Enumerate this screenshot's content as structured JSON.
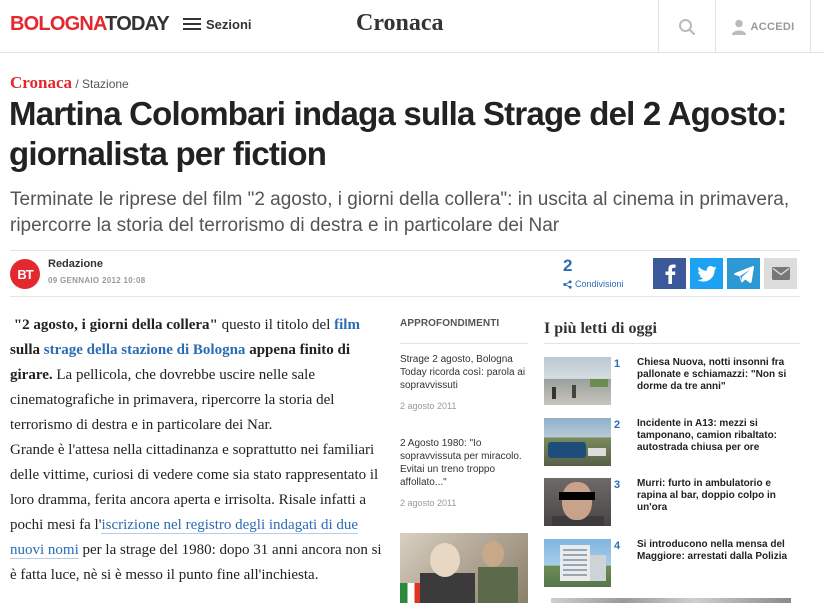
{
  "header": {
    "logo_part1": "BOLOGNA",
    "logo_part2": "TODAY",
    "menu_label": "Sezioni",
    "section_title": "Cronaca",
    "login_label": "ACCEDI"
  },
  "breadcrumb": {
    "category": "Cronaca",
    "separator": " / ",
    "subcategory": "Stazione"
  },
  "article": {
    "title": "Martina Colombari indaga sulla Strage del 2 Agosto: giornalista per fiction",
    "subtitle": "Terminate le riprese del film \"2 agosto, i giorni della collera\": in uscita al cinema in primavera, ripercorre la storia del terrorismo di destra e in particolare dei Nar",
    "author": {
      "avatar_text": "BT",
      "name": "Redazione",
      "date": "09 GENNAIO 2012 10:08"
    },
    "shares": {
      "count": "2",
      "label": "Condivisioni"
    },
    "body": {
      "p1_quote": "\"2 agosto, i giorni della collera\"",
      "p1_a": " questo il titolo del ",
      "link_film": "film",
      "p1_b": " sulla ",
      "link_strage": "strage della stazione di Bologna",
      "p1_c": " appena finito di girare.",
      "p1_d": " La pellicola, che dovrebbe uscire nelle sale cinematografiche in primavera, ripercorre la storia del terrorismo di destra e in particolare dei Nar.",
      "p2_a": "Grande è l'attesa nella cittadinanza e soprattutto nei familiari delle vittime, curiosi di vedere come sia stato rappresentato il loro dramma, ferita ancora aperta e irrisolta. Risale infatti a pochi mesi fa l'",
      "link_iscrizione": "iscrizione nel registro degli indagati di due nuovi nomi",
      "p2_b": " per la strage del 1980: dopo 31 anni ancora non si è fatta luce, nè si è messo il punto fine all'inchiesta."
    }
  },
  "approfondimenti": {
    "heading": "APPROFONDIMENTI",
    "items": [
      {
        "title": "Strage 2 agosto, Bologna Today ricorda così: parola ai sopravvissuti",
        "date": "2 agosto 2011"
      },
      {
        "title": "2 Agosto 1980: \"Io sopravvissuta per miracolo. Evitai un treno troppo affollato...\"",
        "date": "2 agosto 2011"
      }
    ]
  },
  "piu_letti": {
    "heading": "I più letti di oggi",
    "items": [
      {
        "num": "1",
        "title": "Chiesa Nuova, notti insonni fra pallonate e schiamazzi: \"Non si dorme da tre anni\""
      },
      {
        "num": "2",
        "title": "Incidente in A13: mezzi si tamponano, camion ribaltato: autostrada chiusa per ore"
      },
      {
        "num": "3",
        "title": "Murri: furto in ambulatorio e rapina al bar, doppio colpo in un'ora"
      },
      {
        "num": "4",
        "title": "Si introducono nella mensa del Maggiore: arrestati dalla Polizia"
      }
    ]
  },
  "colors": {
    "brand_red": "#e3282e",
    "link_blue": "#2c6cb5",
    "facebook": "#3b5998",
    "twitter": "#1da1f2",
    "telegram": "#2c98d4"
  },
  "icons": [
    "menu-icon",
    "search-icon",
    "user-icon",
    "share-icon",
    "facebook-icon",
    "twitter-icon",
    "telegram-icon",
    "mail-icon"
  ]
}
